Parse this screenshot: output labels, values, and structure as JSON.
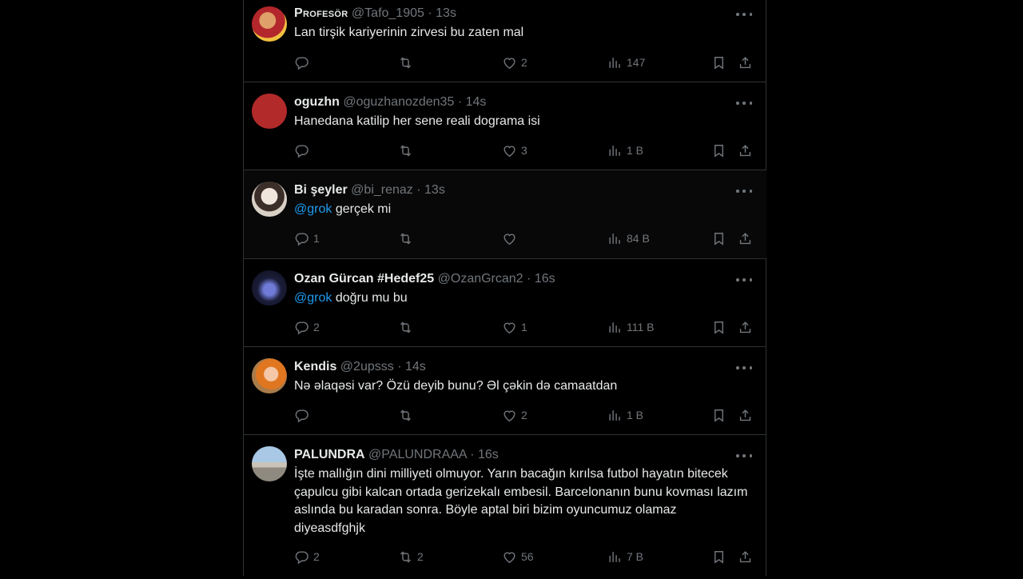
{
  "colors": {
    "background": "#000000",
    "text": "#e7e9ea",
    "muted": "#71767b",
    "mention": "#1d9bf0",
    "border": "#2f3336"
  },
  "icons": {
    "reply": "reply-icon",
    "retweet": "retweet-icon",
    "like": "heart-icon",
    "views": "views-icon",
    "bookmark": "bookmark-icon",
    "share": "share-icon",
    "more": "more-icon"
  },
  "tweets": [
    {
      "name": "Profesör",
      "handle": "@Tafo_1905",
      "separator": "·",
      "time": "13s",
      "text_mention": "",
      "text": "Lan tirşik kariyerinin zirvesi bu zaten mal",
      "replies": "",
      "retweets": "",
      "likes": "2",
      "views": "147"
    },
    {
      "name": "oguzhn",
      "handle": "@oguzhanozden35",
      "separator": "·",
      "time": "14s",
      "text_mention": "",
      "text": "Hanedana katilip her sene reali dograma isi",
      "replies": "",
      "retweets": "",
      "likes": "3",
      "views": "1 B"
    },
    {
      "name": "Bi şeyler",
      "handle": "@bi_renaz",
      "separator": "·",
      "time": "13s",
      "text_mention": "@grok",
      "text": " gerçek mi",
      "replies": "1",
      "retweets": "",
      "likes": "",
      "views": "84 B"
    },
    {
      "name": "Ozan Gürcan #Hedef25",
      "handle": "@OzanGrcan2",
      "separator": "·",
      "time": "16s",
      "text_mention": "@grok",
      "text": " doğru mu bu",
      "replies": "2",
      "retweets": "",
      "likes": "1",
      "views": "111 B"
    },
    {
      "name": "Kendis",
      "handle": "@2upsss",
      "separator": "·",
      "time": "14s",
      "text_mention": "",
      "text": "Nə əlaqəsi var? Özü deyib bunu? Əl çəkin də camaatdan",
      "replies": "",
      "retweets": "",
      "likes": "2",
      "views": "1 B"
    },
    {
      "name": "PALUNDRA",
      "handle": "@PALUNDRAAA",
      "separator": "·",
      "time": "16s",
      "text_mention": "",
      "text": "İşte mallığın dini milliyeti olmuyor. Yarın bacağın kırılsa futbol hayatın bitecek çapulcu gibi kalcan ortada gerizekalı embesil. Barcelonanın bunu kovması lazım aslında bu karadan sonra. Böyle aptal biri bizim oyuncumuz olamaz diyeasdfghjk",
      "replies": "2",
      "retweets": "2",
      "likes": "56",
      "views": "7 B"
    }
  ]
}
